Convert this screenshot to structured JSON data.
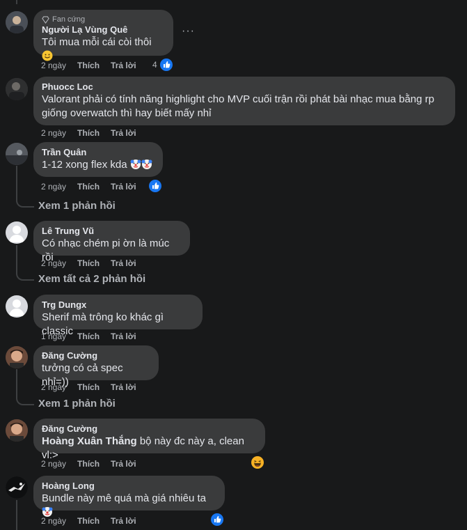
{
  "actions": {
    "like": "Thích",
    "reply": "Trả lời"
  },
  "comments": [
    {
      "author": "Người Lạ Vùng Quê",
      "badge": "Fan cứng",
      "text": "Tôi mua mỗi cái còi thôi",
      "time": "2 ngày",
      "reaction_count": "4",
      "reaction": "like-icon"
    },
    {
      "author": "Phuocc Loc",
      "text": "Valorant phải có tính năng highlight cho MVP cuối trận rồi phát bài nhạc mua bằng rp giống overwatch thì hay biết mấy nhỉ",
      "time": "2 ngày"
    },
    {
      "author": "Trần Quân",
      "text": "1-12 xong flex kda",
      "time": "2 ngày",
      "reaction": "like-icon",
      "replies": "Xem 1 phản hồi"
    },
    {
      "author": "Lê Trung Vũ",
      "text": "Có nhạc chém pi ờn là múc rồi",
      "time": "2 ngày",
      "replies": "Xem tất cả 2 phản hồi"
    },
    {
      "author": "Trg Dungx",
      "text": "Sherif mà trông ko khác gì classic",
      "time": "1 ngày"
    },
    {
      "author": "Đăng Cường",
      "text": "tưởng có cả spec nhỉ=))",
      "time": "2 ngày",
      "replies": "Xem 1 phản hồi"
    },
    {
      "author": "Đăng Cường",
      "mention": "Hoàng Xuân Thắng",
      "text": " bộ này đc này a, clean vl:>",
      "time": "2 ngày",
      "reaction": "haha-icon"
    },
    {
      "author": "Hoàng Long",
      "text": "Bundle này mê quá mà giá nhiêu ta",
      "time": "2 ngày",
      "reaction": "like-icon"
    }
  ],
  "colors": {
    "background": "#18191a",
    "bubble": "#3a3b3c",
    "like_blue": "#1877f2",
    "haha_yellow": "#f7b125"
  }
}
